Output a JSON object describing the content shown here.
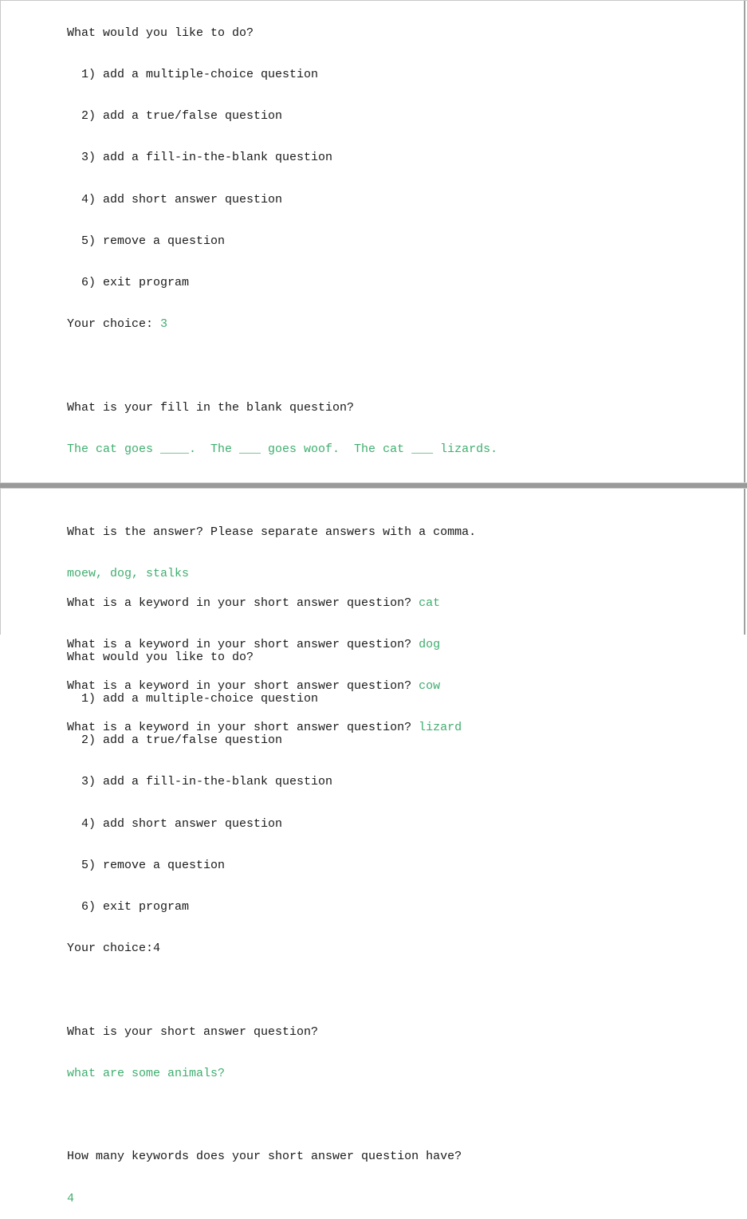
{
  "top_pane": {
    "menu1": {
      "prompt": "What would you like to do?",
      "options": [
        "1) add a multiple-choice question",
        "2) add a true/false question",
        "3) add a fill-in-the-blank question",
        "4) add short answer question",
        "5) remove a question",
        "6) exit program"
      ],
      "choice_label": "Your choice: ",
      "choice_value": "3"
    },
    "fill_blank": {
      "prompt": "What is your fill in the blank question?",
      "input": "The cat goes ____.  The ___ goes woof.  The cat ___ lizards.",
      "answer_prompt": "What is the answer? Please separate answers with a comma.",
      "answer_input": "moew, dog, stalks"
    },
    "menu2": {
      "prompt": "What would you like to do?",
      "options": [
        "1) add a multiple-choice question",
        "2) add a true/false question",
        "3) add a fill-in-the-blank question",
        "4) add short answer question",
        "5) remove a question",
        "6) exit program"
      ],
      "choice_label": "Your choice:",
      "choice_value": "4"
    },
    "short_answer": {
      "prompt": "What is your short answer question?",
      "input": "what are some animals?",
      "keyword_count_prompt": "How many keywords does your short answer question have?",
      "keyword_count_input": "4"
    }
  },
  "bottom_pane": {
    "keyword_prompt": "What is a keyword in your short answer question? ",
    "keywords": [
      "cat",
      "dog",
      "cow",
      "lizard"
    ]
  },
  "colors": {
    "output_text": "#1a1a1a",
    "user_input": "#3fae6e",
    "divider": "#9a9a9a"
  }
}
